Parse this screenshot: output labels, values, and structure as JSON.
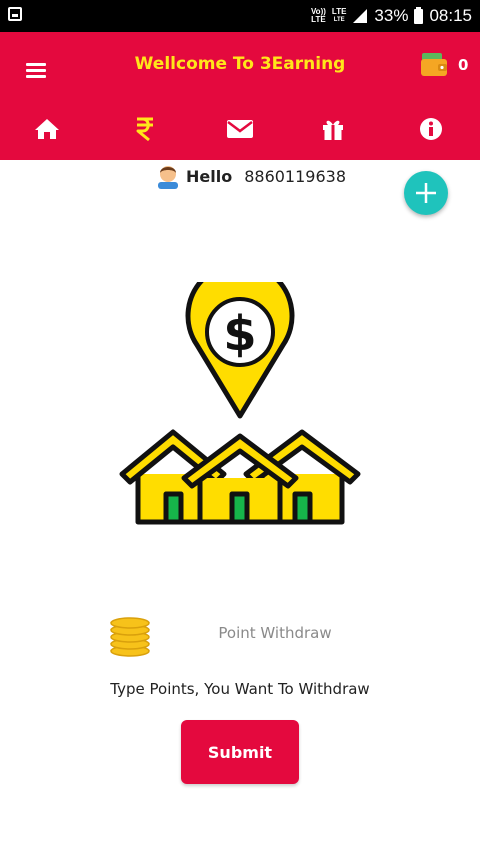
{
  "status_bar": {
    "carrier_top": "Vo))",
    "carrier_bottom": "LTE",
    "network_top": "LTE",
    "network_bottom": "LTE",
    "battery": "33%",
    "time": "08:15"
  },
  "header": {
    "title": "Wellcome To 3Earning",
    "wallet_count": "0",
    "nav_items": [
      {
        "icon": "home-icon"
      },
      {
        "icon": "rupee-icon"
      },
      {
        "icon": "mail-icon"
      },
      {
        "icon": "gift-icon"
      },
      {
        "icon": "info-icon"
      }
    ]
  },
  "user": {
    "greeting": "Hello",
    "phone": "8860119638"
  },
  "withdraw": {
    "placeholder": "Point Withdraw",
    "value": "",
    "hint": "Type Points, You Want To Withdraw",
    "submit_label": "Submit"
  },
  "colors": {
    "brand_red": "#e4093e",
    "title_yellow": "#ffe61a",
    "fab_teal": "#1fc3bc"
  }
}
